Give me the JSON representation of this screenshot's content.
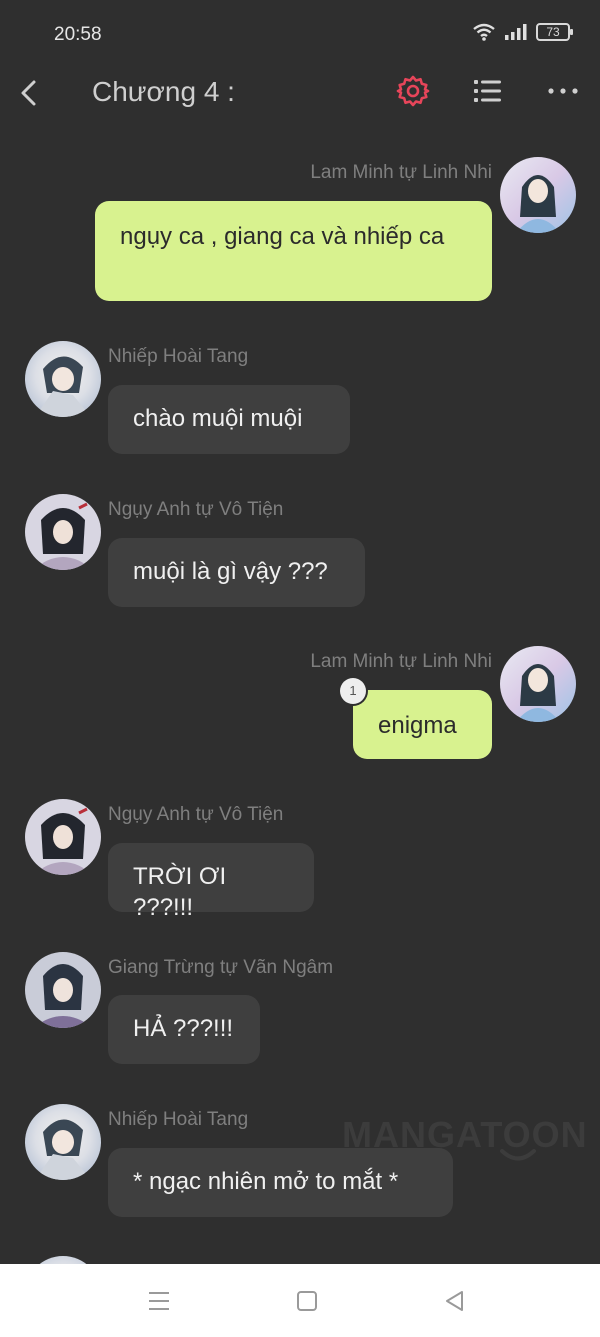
{
  "status_bar": {
    "time": "20:58",
    "battery": "73"
  },
  "header": {
    "title": "Chương 4 :"
  },
  "colors": {
    "background": "#2f2f2f",
    "outgoing_bubble": "#d8f28f",
    "incoming_bubble": "#3f3f3f",
    "gear_accent": "#e7455a"
  },
  "messages": [
    {
      "sender": "Lam Minh tự Linh Nhi",
      "text": "ngụy ca , giang ca và nhiếp ca",
      "direction": "outgoing"
    },
    {
      "sender": "Nhiếp Hoài Tang",
      "text": "chào muội muội",
      "direction": "incoming"
    },
    {
      "sender": "Ngụy Anh tự Vô Tiện",
      "text": "muội là gì vậy ???",
      "direction": "incoming"
    },
    {
      "sender": "Lam Minh tự Linh Nhi",
      "text": "enigma",
      "direction": "outgoing",
      "badge": "1"
    },
    {
      "sender": "Ngụy Anh tự Vô Tiện",
      "text": "TRỜI ƠI ???!!!",
      "direction": "incoming"
    },
    {
      "sender": "Giang Trừng tự Vãn Ngâm",
      "text": "HẢ ???!!!",
      "direction": "incoming"
    },
    {
      "sender": "Nhiếp Hoài Tang",
      "text": "* ngạc nhiên mở to mắt *",
      "direction": "incoming"
    }
  ],
  "watermark": "MANGATOON",
  "icons": {
    "back": "back-arrow-icon",
    "settings": "gear-icon",
    "chapters": "list-icon",
    "more": "more-dots-icon"
  }
}
